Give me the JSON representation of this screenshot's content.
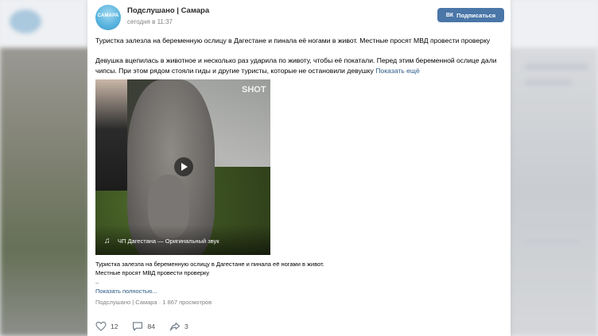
{
  "group": {
    "name": "Подслушано | Самара",
    "time": "сегодня в 11:37",
    "avatar_text": "САМАРА",
    "subscribe_label": "Подписаться",
    "subscribe_prefix": "ВК"
  },
  "post": {
    "headline": "Туристка залезла на беременную ослицу в Дагестане и пинала её ногами в живот. Местные просят МВД провести проверку",
    "body": "Девушка вцепилась в животное и несколько раз ударила по животу, чтобы её покатали. Перед этим беременной ослице дали чипсы. При этом рядом стояли гиды и другие туристы, которые не остановили девушку",
    "show_more": "Показать ещё"
  },
  "video": {
    "watermark": "SHOT",
    "sound_label": "ЧП Дагестана — Оригинальный звук"
  },
  "caption": {
    "line1": "Туристка залезла на беременную ослицу в Дагестане и пинала её ногами в живот.",
    "line2": "Местные просят МВД провести проверку",
    "line3": "..",
    "show_full": "Показать полностью..."
  },
  "meta": "Подслушано | Самара · 1 867 просмотров",
  "actions": {
    "likes": "12",
    "comments": "84",
    "shares": "3"
  },
  "colors": {
    "accent": "#4a76a8",
    "link": "#2a5885"
  }
}
